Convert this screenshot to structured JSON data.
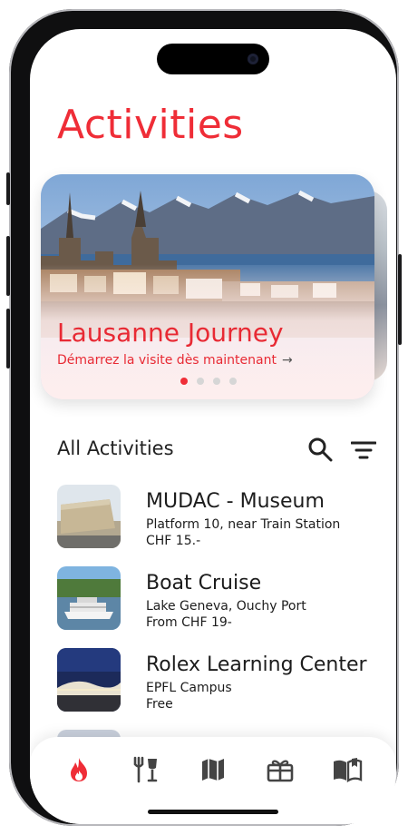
{
  "header": {
    "title": "Activities"
  },
  "hero": {
    "title": "Lausanne Journey",
    "subtitle": "Démarrez la visite dès maintenant",
    "arrow": "→",
    "page_count": 4,
    "active_index": 0
  },
  "activities": {
    "section_title": "All Activities",
    "items": [
      {
        "title": "MUDAC - Museum",
        "subtitle": "Platform 10, near Train Station",
        "price": "CHF 15.-"
      },
      {
        "title": "Boat Cruise",
        "subtitle": "Lake Geneva, Ouchy Port",
        "price": "From CHF 19-"
      },
      {
        "title": "Rolex Learning Center",
        "subtitle": "EPFL Campus",
        "price": "Free"
      }
    ]
  },
  "nav": {
    "items": [
      "flame-icon",
      "food-drink-icon",
      "map-icon",
      "gift-icon",
      "guide-book-icon"
    ],
    "active": "flame-icon"
  },
  "colors": {
    "accent": "#ef2d37",
    "icon": "#444444",
    "text": "#1c1c1c"
  }
}
